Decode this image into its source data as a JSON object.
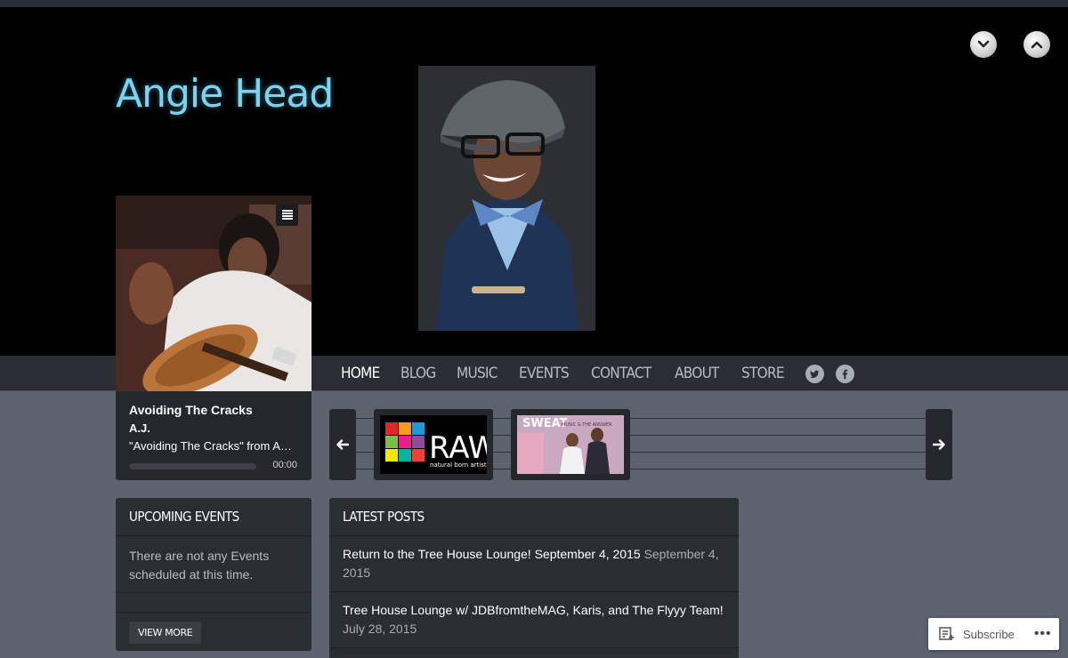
{
  "site": {
    "logo_text": "Angie Head"
  },
  "header_controls": {
    "collapse_icon": "chevron-down-icon",
    "expand_icon": "chevron-up-icon"
  },
  "nav": {
    "items": [
      {
        "label": "HOME",
        "active": true
      },
      {
        "label": "BLOG",
        "active": false
      },
      {
        "label": "MUSIC",
        "active": false
      },
      {
        "label": "EVENTS",
        "active": false
      },
      {
        "label": "CONTACT",
        "active": false
      },
      {
        "label": "ABOUT",
        "active": false
      },
      {
        "label": "STORE",
        "active": false
      }
    ],
    "social": [
      "twitter-icon",
      "facebook-icon"
    ]
  },
  "player": {
    "title": "Avoiding The Cracks",
    "artist": "A.J.",
    "subtitle": "\"Avoiding The Cracks\" from A…",
    "time": "00:00",
    "menu_icon": "playlist-menu-icon"
  },
  "carousel": {
    "prev_icon": "arrow-left-icon",
    "next_icon": "arrow-right-icon",
    "items": [
      {
        "text": "RAW",
        "subtext": "natural born artists"
      },
      {
        "text": "SWEAT",
        "subtext": "MUSIC & THE ANSWER"
      }
    ]
  },
  "events_widget": {
    "heading": "UPCOMING EVENTS",
    "body": "There are not any Events scheduled at this time.",
    "button": "VIEW MORE"
  },
  "posts_widget": {
    "heading": "LATEST POSTS",
    "posts": [
      {
        "title": "Return to the Tree House Lounge! September 4, 2015",
        "date": "September 4, 2015"
      },
      {
        "title": "Tree House Lounge w/ JDBfromtheMAG, Karis, and The Flyyy Team!",
        "date": "July 28, 2015"
      }
    ]
  },
  "subscribe": {
    "label": "Subscribe",
    "more": "•••"
  }
}
